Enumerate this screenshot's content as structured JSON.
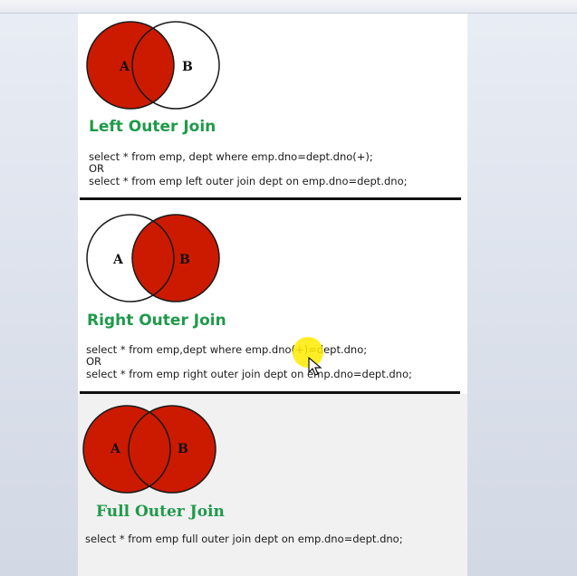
{
  "sections": [
    {
      "title": "Left Outer Join",
      "label_a": "A",
      "label_b": "B",
      "lines": [
        "select * from emp, dept where emp.dno=dept.dno(+);",
        "OR",
        "select * from emp left outer join dept on emp.dno=dept.dno;"
      ]
    },
    {
      "title": "Right Outer Join",
      "label_a": "A",
      "label_b": "B",
      "lines": [
        "select * from emp,dept where emp.dno(+)=dept.dno;",
        "OR",
        "select * from emp right outer join dept on emp.dno=dept.dno;"
      ]
    },
    {
      "title": "Full Outer Join",
      "label_a": "A",
      "label_b": "B",
      "lines": [
        "select * from emp full outer join dept on emp.dno=dept.dno;"
      ]
    }
  ],
  "colors": {
    "fill_red": "#cc1a00",
    "title_green": "#1f9a4a"
  }
}
